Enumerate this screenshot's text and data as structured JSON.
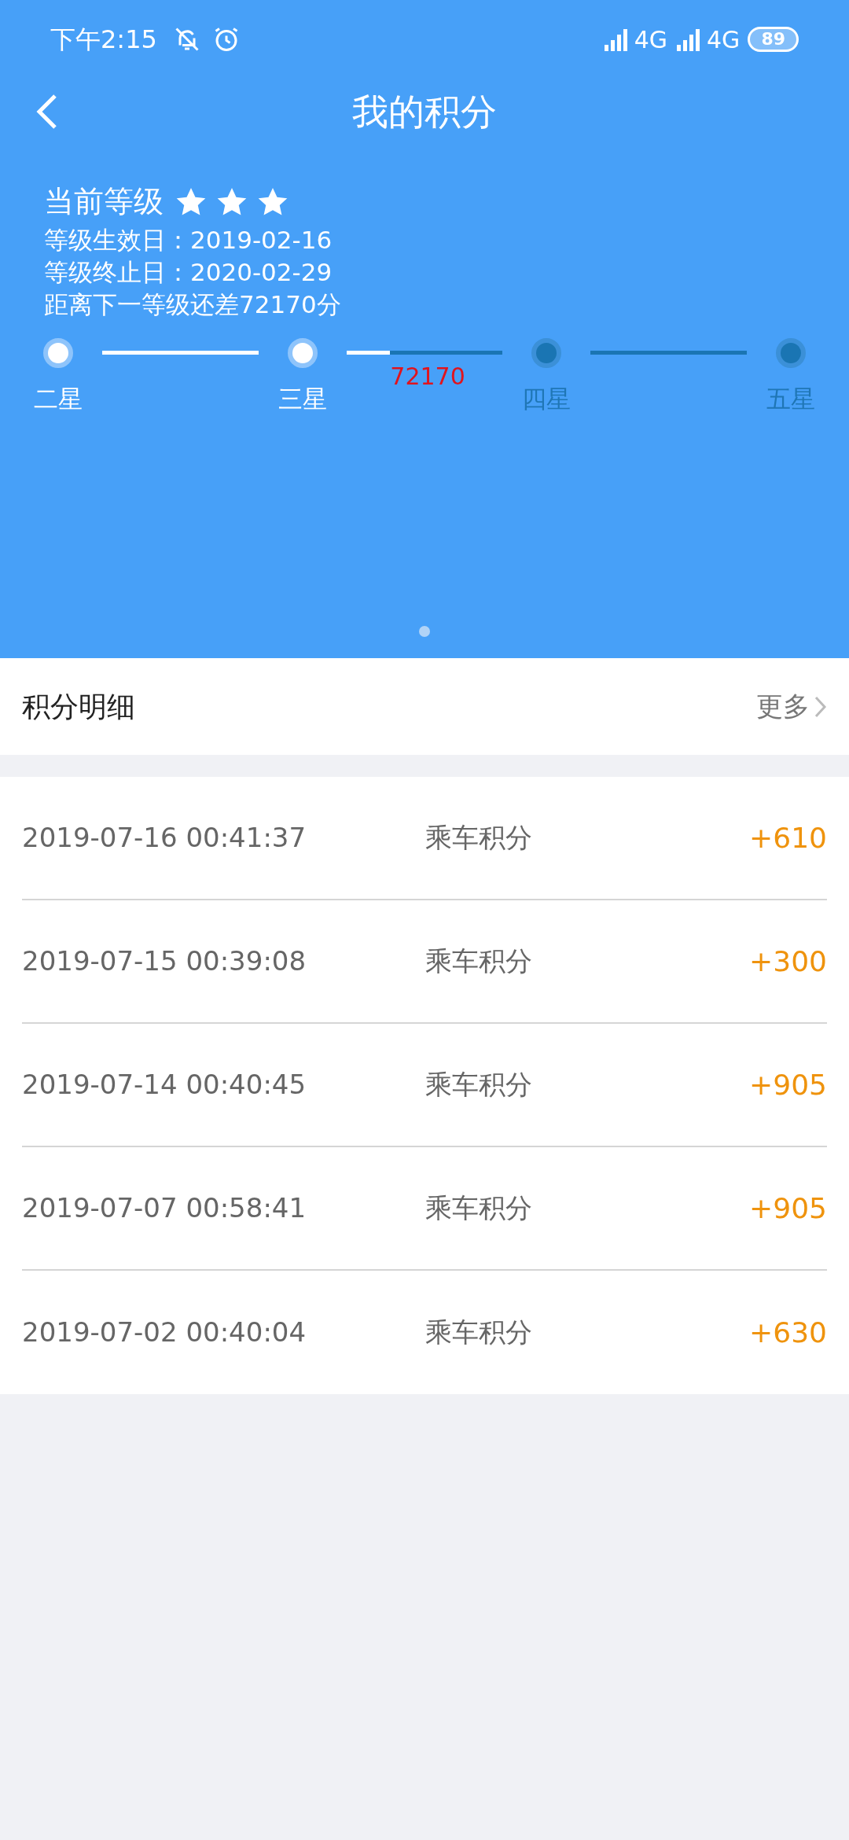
{
  "status_bar": {
    "time": "下午2:15",
    "network_labels": [
      "4G",
      "4G"
    ],
    "battery": "89"
  },
  "header": {
    "title": "我的积分"
  },
  "level": {
    "label": "当前等级",
    "stars": 3,
    "lines": [
      "等级生效日：2019-02-16",
      "等级终止日：2020-02-29",
      "距离下一等级还差72170分"
    ]
  },
  "progress": {
    "tiers": [
      {
        "label": "二星",
        "reached": true
      },
      {
        "label": "三星",
        "reached": true
      },
      {
        "label": "四星",
        "reached": false
      },
      {
        "label": "五星",
        "reached": false
      }
    ],
    "segments": [
      {
        "level": 1
      },
      {
        "level": 0.28,
        "reading": "72170"
      },
      {
        "level": 0
      }
    ]
  },
  "details": {
    "title": "积分明细",
    "more": "更多"
  },
  "records": [
    {
      "time": "2019-07-16 00:41:37",
      "type": "乘车积分",
      "points": "+610"
    },
    {
      "time": "2019-07-15 00:39:08",
      "type": "乘车积分",
      "points": "+300"
    },
    {
      "time": "2019-07-14 00:40:45",
      "type": "乘车积分",
      "points": "+905"
    },
    {
      "time": "2019-07-07 00:58:41",
      "type": "乘车积分",
      "points": "+905"
    },
    {
      "time": "2019-07-02 00:40:04",
      "type": "乘车积分",
      "points": "+630"
    }
  ]
}
